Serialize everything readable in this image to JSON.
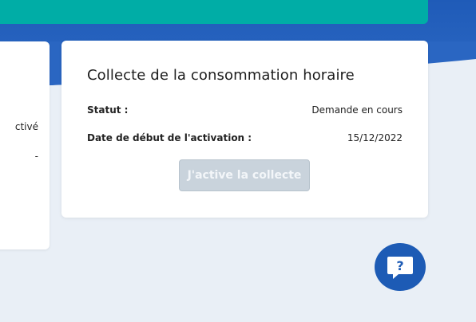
{
  "left_card": {
    "text1": "ctivé",
    "text2": "-"
  },
  "card": {
    "title": "Collecte de la consommation horaire",
    "rows": [
      {
        "label": "Statut :",
        "value": "Demande en cours"
      },
      {
        "label": "Date de début de l'activation :",
        "value": "15/12/2022"
      }
    ],
    "button_label": "J'active la collecte"
  },
  "help_button": {
    "icon": "question-chat-icon",
    "glyph": "?"
  },
  "colors": {
    "teal": "#00ada6",
    "blue": "#1f5bb8",
    "background": "#e9eff6",
    "button_disabled": "#c9d3dc",
    "help_button": "#1d5bb5"
  }
}
